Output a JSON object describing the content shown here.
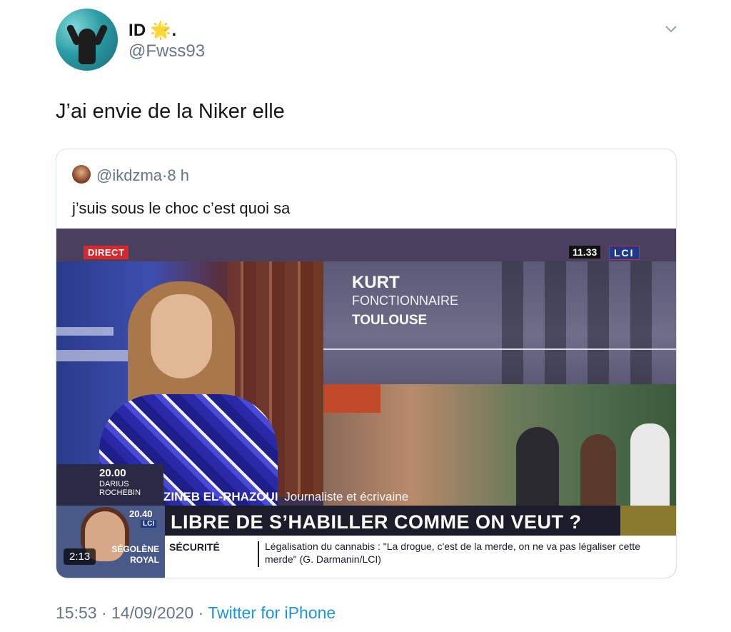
{
  "author": {
    "display_name": "ID",
    "badge_emoji": "🌟",
    "name_suffix": ".",
    "handle": "@Fwss93"
  },
  "tweet": {
    "text": "J’ai envie de la Niker elle"
  },
  "quoted_tweet": {
    "handle": "@ikdzma",
    "separator": "·",
    "time_ago": "8 h",
    "text": "j’suis sous le choc c’est quoi sa",
    "video": {
      "duration": "2:13",
      "live_badge": "DIRECT",
      "clock": "11.33",
      "channel_logo": "LCI",
      "kurt_name": "KURT",
      "kurt_job": "FONCTIONNAIRE",
      "kurt_city": "TOULOUSE",
      "guest_time": "20.00",
      "guest_name_line1": "DARIUS",
      "guest_name_line2": "ROCHEBIN",
      "presenter_name": "ZINEB EL-RHAZOUI",
      "presenter_role": "Journaliste et écrivaine",
      "seg_time": "20.40",
      "seg_logo": "LCI",
      "seg_name_line1": "SÉGOLÈNE",
      "seg_name_line2": "ROYAL",
      "headline": "LIBRE DE S’HABILLER COMME ON VEUT ?",
      "ticker_label": "SÉCURITÉ",
      "ticker_text": "Légalisation du cannabis : \"La drogue, c'est de la merde, on ne va pas légaliser cette merde\" (G. Darmanin/LCI)"
    }
  },
  "meta": {
    "time": "15:53",
    "separator": "·",
    "date": "14/09/2020",
    "source": "Twitter for iPhone"
  },
  "icons": {
    "chevron": "chevron-down-icon"
  }
}
